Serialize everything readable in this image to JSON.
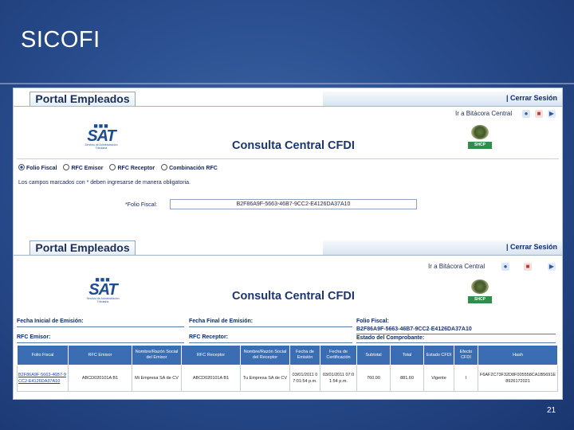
{
  "slide": {
    "title": "SICOFI",
    "number": "21"
  },
  "portal": {
    "title": "Portal Empleados",
    "logout": "| Cerrar Sesión",
    "bitacora_top": "Ir a Bitácora Central",
    "bitacora_bottom": "Ir a Bitácora Central",
    "page_heading": "Consulta Central CFDI",
    "sat_logo": "SAT",
    "sat_subtitle": "Servicio de Administración Tributaria",
    "shcp_label": "SHCP"
  },
  "search": {
    "options": [
      "Folio Fiscal",
      "RFC Emisor",
      "RFC Receptor",
      "Combinación RFC"
    ],
    "selected": "Folio Fiscal",
    "required_note": "Los campos marcados con * deben ingresarse de manera obligatoria.",
    "folio_label": "*Folio Fiscal:",
    "folio_value": "B2F86A9F-5663-46B7-9CC2-E4126DA37A10"
  },
  "result_header": {
    "fecha_inicial_label": "Fecha Inicial de Emisión:",
    "fecha_final_label": "Fecha Final de Emisión:",
    "folio_fiscal_label": "Folio Fiscal:",
    "folio_fiscal_value": "B2F86A9F-5663-46B7-9CC2-E4126DA37A10",
    "rfc_emisor_label": "RFC Emisor:",
    "rfc_receptor_label": "RFC Receptor:",
    "estado_label": "Estado del Comprobante:"
  },
  "table": {
    "columns": [
      "Folio Fiscal",
      "RFC Emisor",
      "Nombre/Razón Social del Emisor",
      "RFC Receptor",
      "Nombre/Razón Social del Receptor",
      "Fecha de Emisión",
      "Fecha de Certificación",
      "Subtotal",
      "Total",
      "Estado CFDI",
      "Efecto CFDI",
      "Hash"
    ],
    "rows": [
      [
        "B2F86A9F-5663-46B7-9CC2-E4126DA37A10",
        "ABCD020101A B1",
        "Mi Empresa SA de CV",
        "ABCD020101A B1",
        "Tu Empresa SA de CV",
        "03/01/2011 07:01:54 p.m.",
        "03/01/2011 07:01:54 p.m.",
        "760.00",
        "881.60",
        "Vigente",
        "I",
        "F6AF2C73F32D8F005558CA1B5691E8926172021"
      ]
    ]
  },
  "colors": {
    "slide_bg": "#2a4e8f",
    "table_header": "#3b6db2",
    "portal_title": "#1b2e55",
    "link": "#1c3fb0"
  },
  "icons": [
    "lock-icon",
    "pdf-icon",
    "export-icon",
    "sat-logo-icon",
    "shcp-eagle-icon"
  ]
}
